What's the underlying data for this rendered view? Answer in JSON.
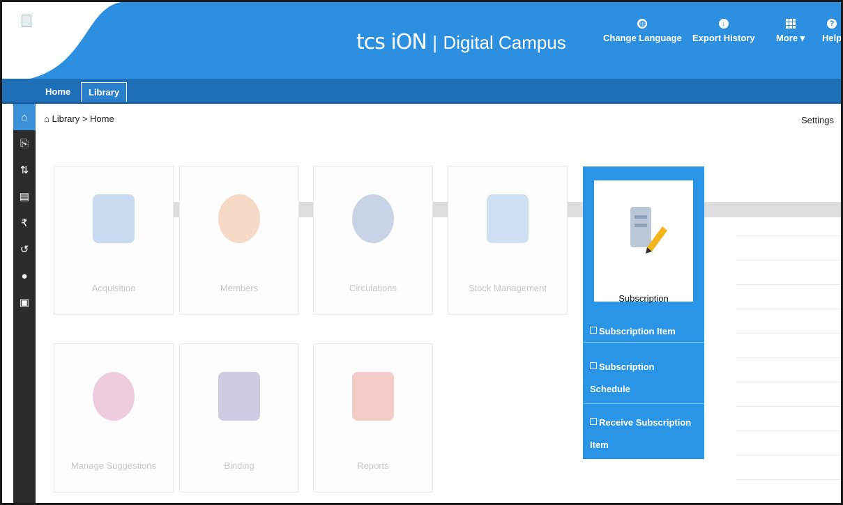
{
  "header": {
    "brand_logo": "tcs iON",
    "brand_separator": "|",
    "brand_subtitle": "Digital Campus",
    "actions": [
      {
        "label": "Change Language",
        "icon": "globe-icon"
      },
      {
        "label": "Export History",
        "icon": "download-icon"
      },
      {
        "label": "More ▾",
        "icon": "grid-icon"
      },
      {
        "label": "Help",
        "icon": "help-icon"
      }
    ]
  },
  "tabs": [
    {
      "label": "Home",
      "active": false
    },
    {
      "label": "Library",
      "active": true
    }
  ],
  "breadcrumb": "Library > Home",
  "settings_label": "Settings",
  "tiles": [
    {
      "label": "Acquisition"
    },
    {
      "label": "Members"
    },
    {
      "label": "Circulations"
    },
    {
      "label": "Stock Management"
    },
    {
      "label": "Manage Suggestions"
    },
    {
      "label": "Binding"
    },
    {
      "label": "Reports"
    }
  ],
  "subscription": {
    "title": "Subscription",
    "links": [
      {
        "label": "Subscription Item"
      },
      {
        "label": "Subscription Schedule"
      },
      {
        "label": "Receive Subscription Item"
      }
    ]
  },
  "colors": {
    "header_blue": "#2c8fe0",
    "tab_bar": "#1e6fb8",
    "sidebar": "#2b2b2b",
    "panel_blue": "#2a95e6"
  }
}
